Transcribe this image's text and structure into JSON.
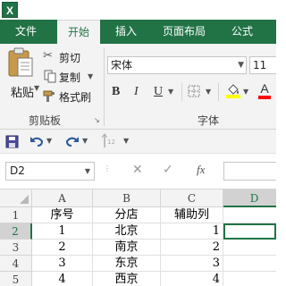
{
  "app": {
    "icon_letter": "X",
    "brand_color": "#217346"
  },
  "tabs": [
    {
      "label": "文件",
      "active": false
    },
    {
      "label": "开始",
      "active": true
    },
    {
      "label": "插入",
      "active": false
    },
    {
      "label": "页面布局",
      "active": false
    },
    {
      "label": "公式",
      "active": false
    }
  ],
  "ribbon": {
    "clipboard": {
      "paste_label": "粘贴",
      "cut_label": "剪切",
      "copy_label": "复制",
      "format_painter_label": "格式刷",
      "group_label": "剪贴板"
    },
    "font": {
      "font_name": "宋体",
      "font_size": "11",
      "bold": "B",
      "italic": "I",
      "underline": "U",
      "font_color_label": "A",
      "group_label": "字体",
      "fill_color": "#ffff00",
      "font_color": "#ff0000"
    }
  },
  "qat": {
    "icons": [
      "save-icon",
      "undo-icon",
      "redo-icon",
      "sort-icon"
    ],
    "sort_badge": "12"
  },
  "formula_bar": {
    "name_box": "D2",
    "fx": "fx",
    "formula": ""
  },
  "grid": {
    "columns": [
      "A",
      "B",
      "C",
      "D"
    ],
    "selected_column": "D",
    "rows": [
      {
        "num": "1",
        "cells": [
          "序号",
          "分店",
          "辅助列",
          ""
        ]
      },
      {
        "num": "2",
        "cells": [
          "1",
          "北京",
          "1",
          ""
        ]
      },
      {
        "num": "3",
        "cells": [
          "2",
          "南京",
          "2",
          ""
        ]
      },
      {
        "num": "4",
        "cells": [
          "3",
          "东京",
          "3",
          ""
        ]
      },
      {
        "num": "5",
        "cells": [
          "4",
          "西京",
          "4",
          ""
        ]
      }
    ],
    "selected_row": "2",
    "active_cell": "D2"
  }
}
